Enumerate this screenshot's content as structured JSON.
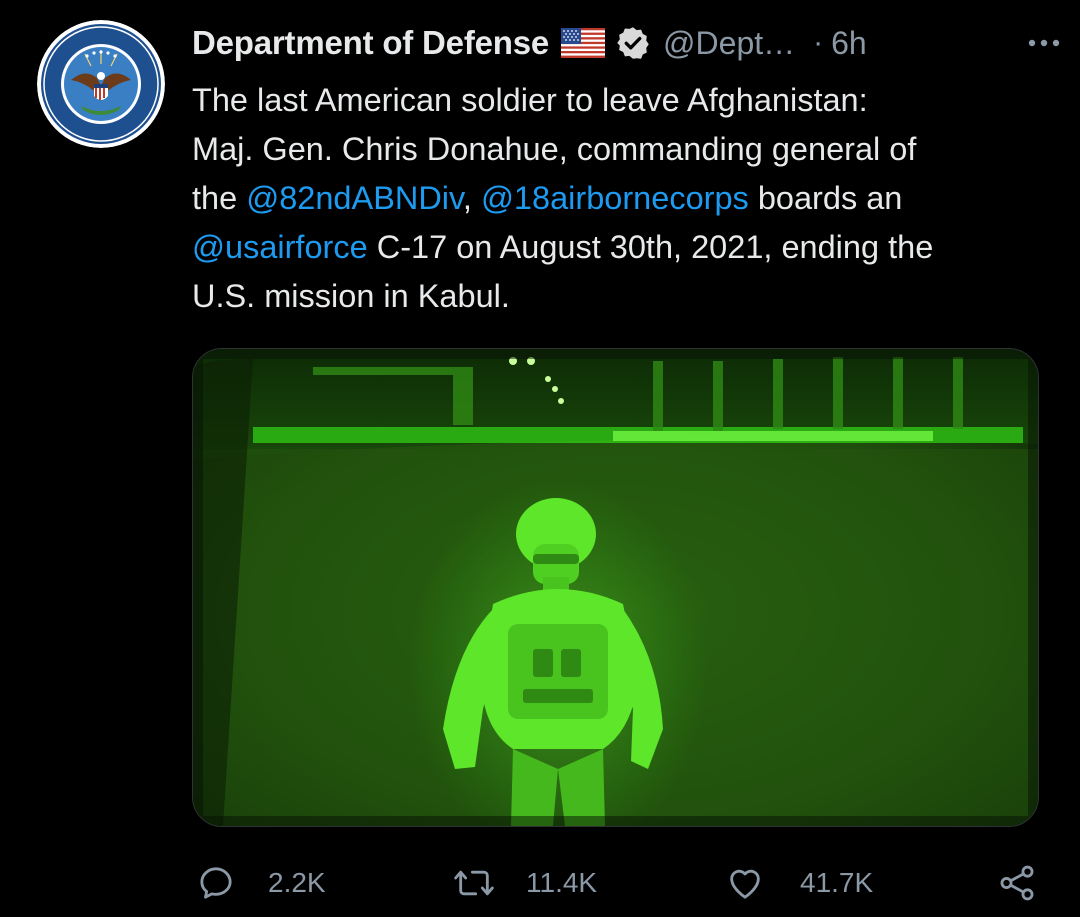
{
  "tweet": {
    "author": {
      "display_name": "Department of Defense",
      "handle": "@Dept…",
      "avatar_icon": "department-of-defense-seal-icon",
      "flag_icon": "us-flag-icon",
      "verified_icon": "verified-badge-icon"
    },
    "separator": "·",
    "time": "6h",
    "more_icon": "more-options-icon",
    "text": {
      "line1": "The last American soldier to leave Afghanistan:",
      "line2": "Maj. Gen. Chris Donahue, commanding general of",
      "line3_pre": "the ",
      "mention1": "@82ndABNDiv",
      "line3_sep": ", ",
      "mention2": "@18airbornecorps",
      "line3_post": " boards an",
      "mention3": "@usairforce",
      "line4_post": " C-17 on August 30th, 2021, ending the",
      "line5": "U.S. mission in Kabul."
    },
    "media": {
      "kind": "night-vision-photo",
      "dominant_color": "#39ff14"
    },
    "actions": {
      "replies": "2.2K",
      "retweets": "11.4K",
      "likes": "41.7K",
      "reply_icon": "reply-icon",
      "retweet_icon": "retweet-icon",
      "like_icon": "heart-icon",
      "share_icon": "share-icon"
    }
  },
  "colors": {
    "background": "#000000",
    "text": "#e7e9ea",
    "secondary": "#8b98a5",
    "link": "#1d9bf0"
  }
}
